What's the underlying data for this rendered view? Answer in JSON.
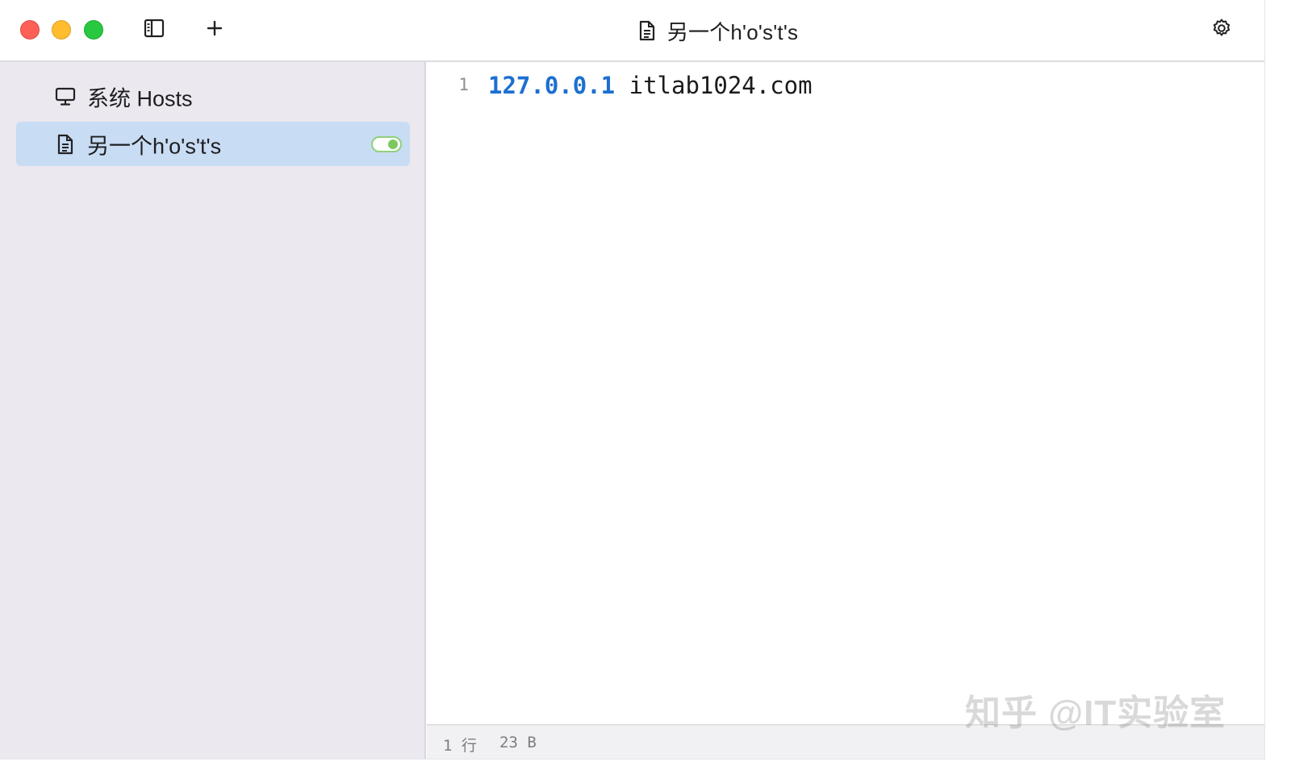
{
  "titlebar": {
    "title": "另一个h'o's't's",
    "title_icon": "document-icon",
    "sidebar_toggle_icon": "sidebar-toggle-icon",
    "add_icon": "plus-icon",
    "settings_icon": "gear-icon"
  },
  "sidebar": {
    "items": [
      {
        "label": "系统 Hosts",
        "icon": "monitor-icon",
        "selected": false
      },
      {
        "label": "另一个h'o's't's",
        "icon": "document-icon",
        "selected": true,
        "enabled": true
      }
    ]
  },
  "editor": {
    "lines": [
      {
        "number": "1",
        "ip": "127.0.0.1",
        "host": "itlab1024.com"
      }
    ]
  },
  "statusbar": {
    "lines": "1 行",
    "size": "23 B"
  },
  "watermark": "知乎 @IT实验室",
  "colors": {
    "sidebar_bg": "#ebe8ef",
    "selected_bg": "#c8dcf3",
    "ip_color": "#1d6fd1",
    "toggle_on": "#7cc95e"
  }
}
